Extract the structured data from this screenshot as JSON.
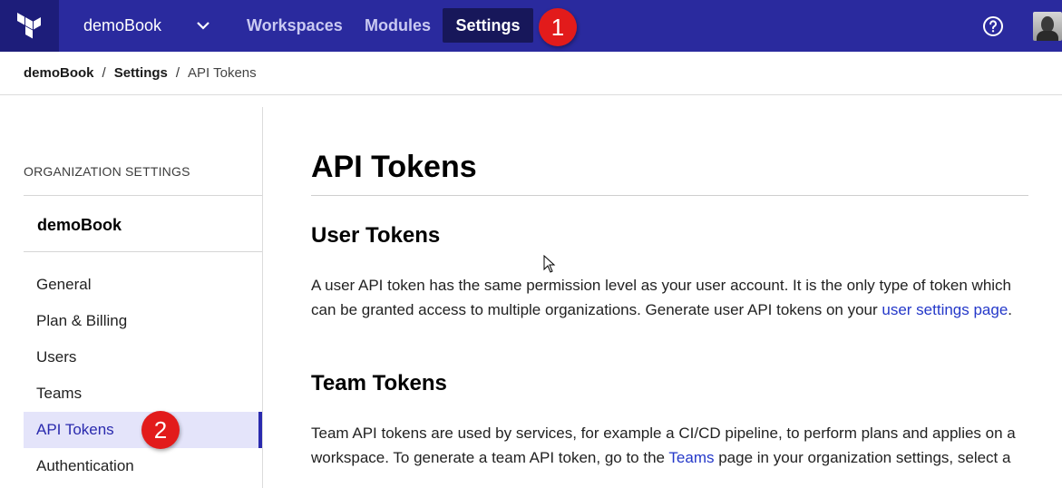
{
  "topnav": {
    "org_name": "demoBook",
    "links": {
      "workspaces": "Workspaces",
      "modules": "Modules",
      "settings": "Settings"
    },
    "badge_1": "1",
    "colors": {
      "bar": "#2a2a9e",
      "logo_bg": "#1d1d7a",
      "active_bg": "#17175a"
    }
  },
  "breadcrumb": {
    "items": [
      "demoBook",
      "Settings",
      "API Tokens"
    ],
    "separator": "/"
  },
  "sidebar": {
    "heading": "ORGANIZATION SETTINGS",
    "org": "demoBook",
    "items": [
      {
        "label": "General"
      },
      {
        "label": "Plan & Billing"
      },
      {
        "label": "Users"
      },
      {
        "label": "Teams"
      },
      {
        "label": "API Tokens",
        "active": true
      },
      {
        "label": "Authentication"
      }
    ],
    "badge_2": "2"
  },
  "main": {
    "title": "API Tokens",
    "user_tokens": {
      "heading": "User Tokens",
      "text_a": "A user API token has the same permission level as your user account. It is the only type of token which can be granted access to multiple organizations. Generate user API tokens on your ",
      "link": "user settings page",
      "text_b": "."
    },
    "team_tokens": {
      "heading": "Team Tokens",
      "text_a": "Team API tokens are used by services, for example a CI/CD pipeline, to perform plans and applies on a workspace. To generate a team API token, go to the ",
      "link": "Teams",
      "text_b": " page in your organization settings, select a"
    }
  }
}
